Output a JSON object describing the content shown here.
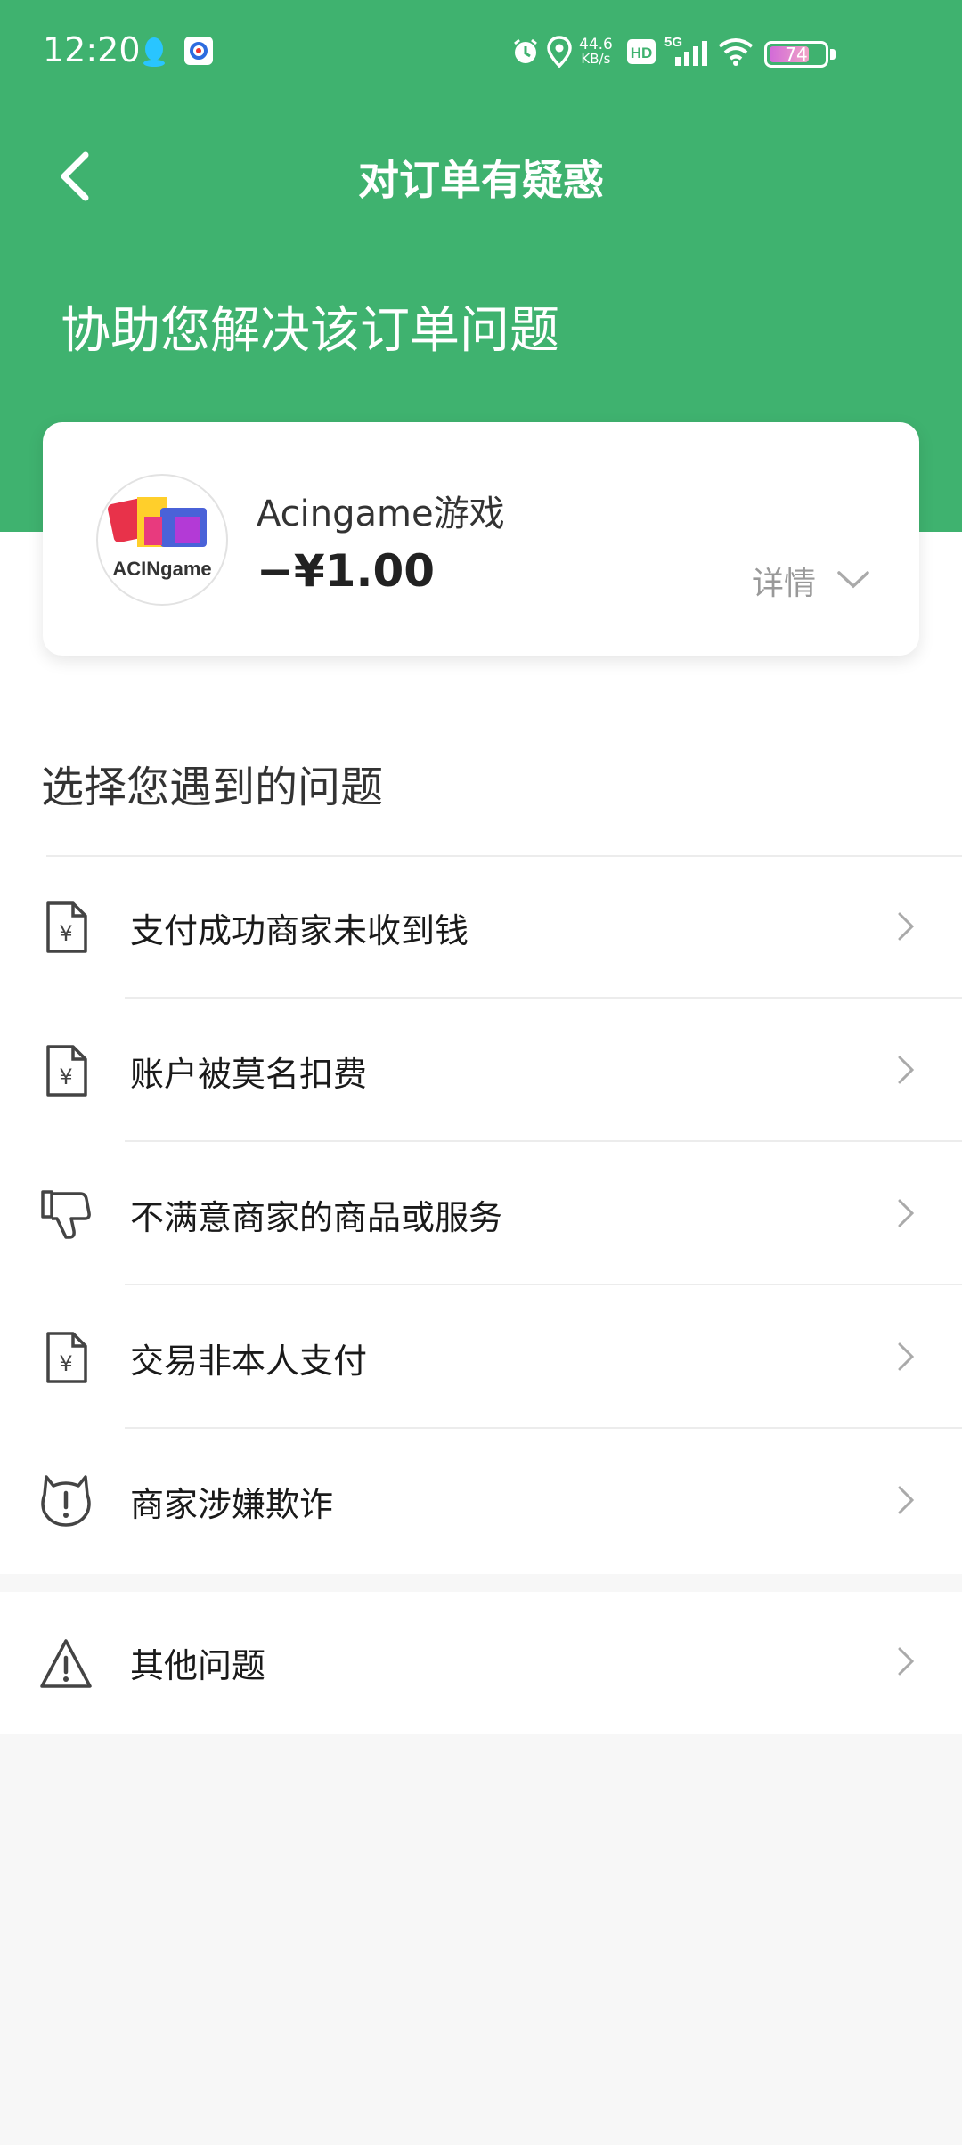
{
  "status_bar": {
    "time": "12:20",
    "speed_value": "44.6",
    "speed_unit": "KB/s",
    "hd": "HD",
    "network": "5G",
    "battery": "74",
    "battery_level": 0.74
  },
  "nav": {
    "back_icon": "chevron-left-icon",
    "title": "对订单有疑惑"
  },
  "header": {
    "subtitle": "协助您解决该订单问题"
  },
  "order": {
    "merchant_name": "Acingame游戏",
    "amount": "−¥1.00",
    "details_label": "详情",
    "logo_text": "ACINgame"
  },
  "issues": {
    "section_title": "选择您遇到的问题",
    "items": [
      {
        "label": "支付成功商家未收到钱",
        "icon": "yuan-document-icon"
      },
      {
        "label": "账户被莫名扣费",
        "icon": "yuan-document-icon"
      },
      {
        "label": "不满意商家的商品或服务",
        "icon": "thumbs-down-icon"
      },
      {
        "label": "交易非本人支付",
        "icon": "yuan-document-icon"
      },
      {
        "label": "商家涉嫌欺诈",
        "icon": "alert-shield-icon"
      }
    ],
    "other": {
      "label": "其他问题",
      "icon": "warning-triangle-icon"
    }
  },
  "colors": {
    "brand_green": "#3fb26f",
    "background": "#f7f7f7",
    "divider": "#ececec"
  }
}
